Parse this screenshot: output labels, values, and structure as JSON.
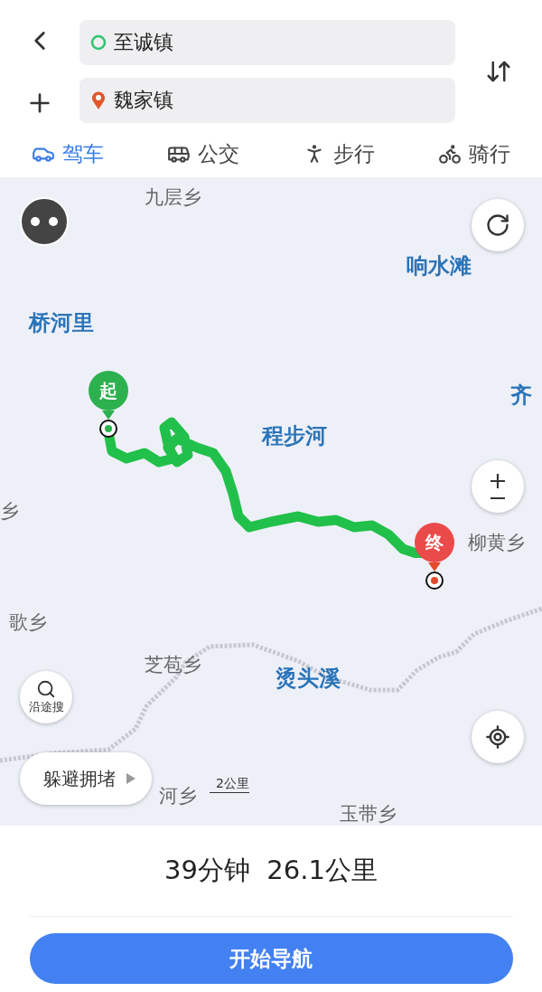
{
  "route_inputs": [
    {
      "kind": "origin",
      "value": "至诚镇"
    },
    {
      "kind": "destination",
      "value": "魏家镇"
    }
  ],
  "modes": [
    {
      "kind": "car",
      "label": "驾车",
      "selected": true
    },
    {
      "kind": "bus",
      "label": "公交",
      "selected": false
    },
    {
      "kind": "walk",
      "label": "步行",
      "selected": false
    },
    {
      "kind": "bike",
      "label": "骑行",
      "selected": false
    }
  ],
  "map": {
    "labels": [
      {
        "kind": "place",
        "text": "九层乡"
      },
      {
        "kind": "area",
        "text": "响水滩"
      },
      {
        "kind": "area",
        "text": "桥河里"
      },
      {
        "kind": "area",
        "text": "齐"
      },
      {
        "kind": "area",
        "text": "程步河"
      },
      {
        "kind": "place",
        "text": "乡"
      },
      {
        "kind": "place",
        "text": "柳黄乡"
      },
      {
        "kind": "place",
        "text": "歌乡"
      },
      {
        "kind": "place",
        "text": "芝苞乡"
      },
      {
        "kind": "area",
        "text": "烫头溪"
      },
      {
        "kind": "place",
        "text": "河乡"
      },
      {
        "kind": "place",
        "text": "玉带乡"
      }
    ],
    "start_marker": "起",
    "end_marker": "终",
    "search_along": "沿途搜",
    "avoid_congestion": "躲避拥堵",
    "scale": "2公里"
  },
  "summary": "39分钟  26.1公里",
  "start_button": "开始导航"
}
